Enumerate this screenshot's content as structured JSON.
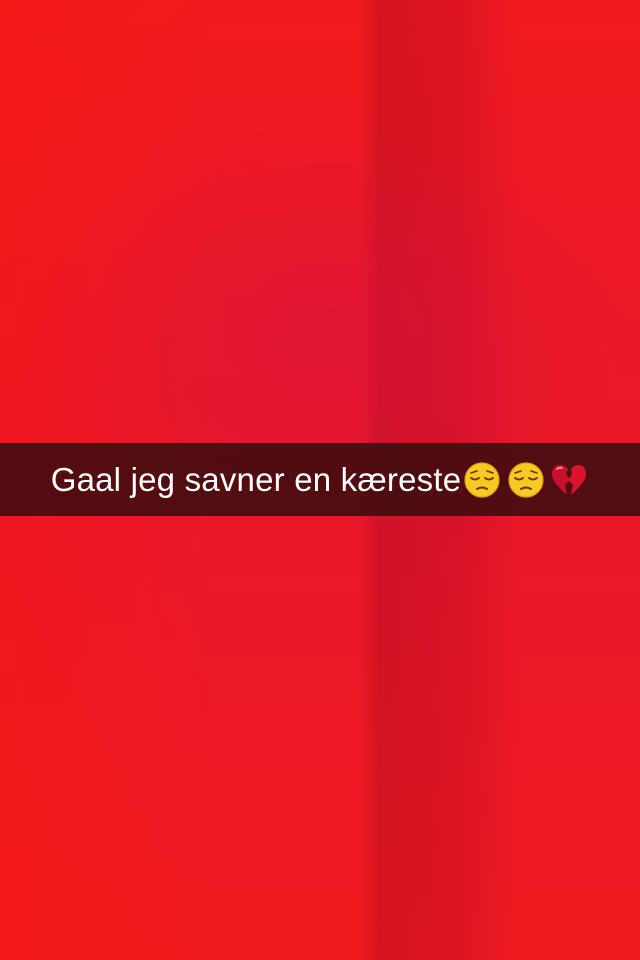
{
  "caption": {
    "text": "Gaal jeg savner en kæreste",
    "emojis": [
      "pensive-face-icon",
      "pensive-face-icon",
      "broken-heart-icon"
    ]
  },
  "colors": {
    "background": "#ee1a22",
    "caption_bar": "#280a0c",
    "caption_text": "#ffffff"
  }
}
